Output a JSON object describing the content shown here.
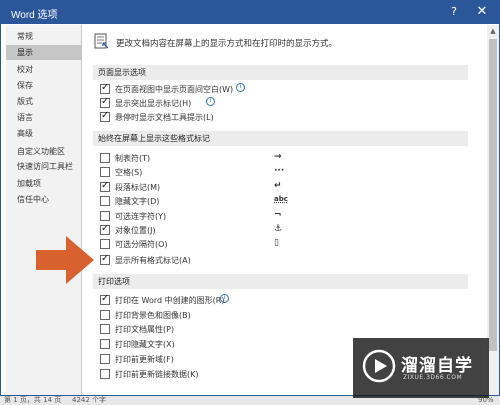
{
  "window": {
    "title": "Word 选项",
    "help": "?",
    "close": "✕"
  },
  "sidebar": {
    "items": [
      {
        "label": "常规"
      },
      {
        "label": "显示",
        "active": true
      },
      {
        "label": "校对"
      },
      {
        "label": "保存"
      },
      {
        "label": "版式"
      },
      {
        "label": "语言"
      },
      {
        "label": "高级"
      },
      {
        "label": "自定义功能区"
      },
      {
        "label": "快速访问工具栏"
      },
      {
        "label": "加载项"
      },
      {
        "label": "信任中心"
      }
    ]
  },
  "content": {
    "header": "更改文档内容在屏幕上的显示方式和在打印时的显示方式。",
    "page_display": {
      "title": "页面显示选项",
      "items": [
        {
          "label": "在页面视图中显示页面间空白(W)",
          "checked": true,
          "info": true
        },
        {
          "label": "显示突出显示标记(H)",
          "checked": true,
          "info": true
        },
        {
          "label": "悬停时显示文档工具提示(L)",
          "checked": true
        }
      ]
    },
    "format_marks": {
      "title": "始终在屏幕上显示这些格式标记",
      "items": [
        {
          "label": "制表符(T)",
          "checked": false,
          "symbol": "→"
        },
        {
          "label": "空格(S)",
          "checked": false,
          "symbol": "···"
        },
        {
          "label": "段落标记(M)",
          "checked": true,
          "symbol": "↵"
        },
        {
          "label": "隐藏文字(D)",
          "checked": false,
          "symbol": "abc"
        },
        {
          "label": "可选连字符(Y)",
          "checked": false,
          "symbol": "¬"
        },
        {
          "label": "对象位置(J)",
          "checked": true,
          "symbol": "⚓"
        },
        {
          "label": "可选分隔符(O)",
          "checked": false,
          "symbol": "▯"
        },
        {
          "label": "显示所有格式标记(A)",
          "checked": true
        }
      ]
    },
    "print": {
      "title": "打印选项",
      "items": [
        {
          "label": "打印在 Word 中创建的图形(R)",
          "checked": true,
          "info": true
        },
        {
          "label": "打印背景色和图像(B)",
          "checked": false
        },
        {
          "label": "打印文档属性(P)",
          "checked": false
        },
        {
          "label": "打印隐藏文字(X)",
          "checked": false
        },
        {
          "label": "打印前更新域(F)",
          "checked": false
        },
        {
          "label": "打印前更新链接数据(K)",
          "checked": false
        }
      ]
    }
  },
  "statusbar": {
    "page": "第 1 页，共 14 页",
    "words": "4242 个字",
    "zoom": "90%"
  },
  "watermark": {
    "title": "溜溜自学",
    "url": "ZIXUE.3D66.COM"
  },
  "colors": {
    "accent": "#2b579a",
    "arrow": "#d9602f",
    "section_bg": "#ececec"
  }
}
